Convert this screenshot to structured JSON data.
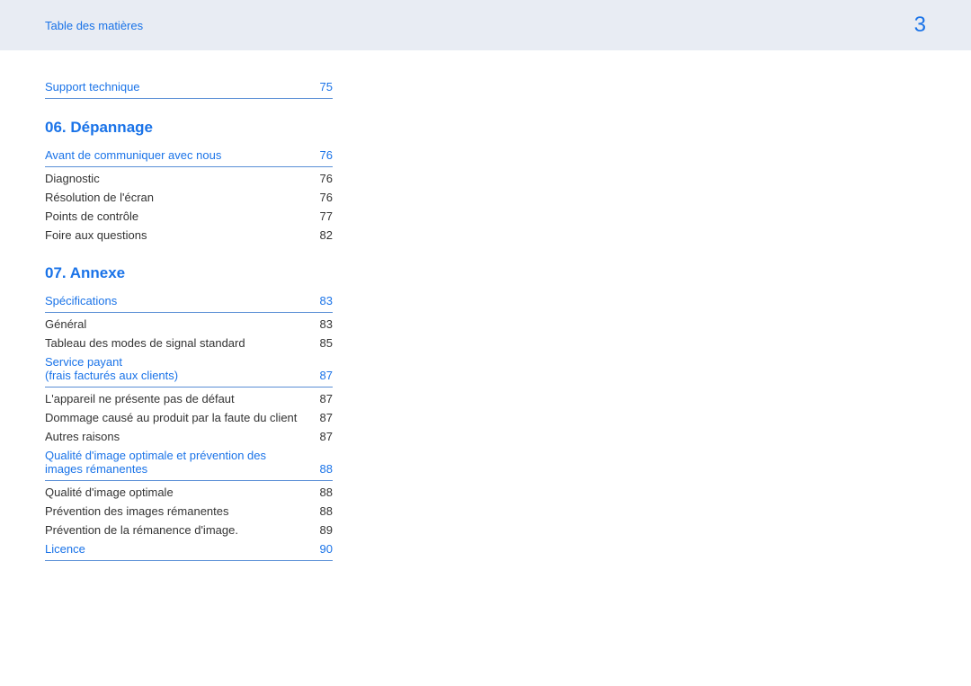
{
  "header": {
    "title": "Table des matières",
    "page_number": "3"
  },
  "top_link": {
    "label": "Support technique",
    "page": "75"
  },
  "sections": [
    {
      "heading": "06. Dépannage",
      "groups": [
        {
          "main": {
            "label": "Avant de communiquer avec nous",
            "page": "76"
          },
          "items": [
            {
              "label": "Diagnostic",
              "page": "76"
            },
            {
              "label": "Résolution de l'écran",
              "page": "76"
            },
            {
              "label": "Points de contrôle",
              "page": "77"
            },
            {
              "label": "Foire aux questions",
              "page": "82"
            }
          ]
        }
      ]
    },
    {
      "heading": "07.  Annexe",
      "groups": [
        {
          "main": {
            "label": "Spécifications",
            "page": "83"
          },
          "items": [
            {
              "label": "Général",
              "page": "83"
            },
            {
              "label": "Tableau des modes de signal standard",
              "page": "85"
            }
          ]
        },
        {
          "main": {
            "label": "Service payant\n(frais facturés aux clients)",
            "page": "87"
          },
          "items": [
            {
              "label": "L'appareil ne présente pas de défaut",
              "page": "87"
            },
            {
              "label": "Dommage causé au produit par la faute du client",
              "page": "87"
            },
            {
              "label": "Autres raisons",
              "page": "87"
            }
          ]
        },
        {
          "main": {
            "label": "Qualité d'image optimale et prévention des images rémanentes",
            "page": "88"
          },
          "items": [
            {
              "label": "Qualité d'image optimale",
              "page": "88"
            },
            {
              "label": "Prévention des images rémanentes",
              "page": "88"
            },
            {
              "label": "Prévention de la rémanence d'image.",
              "page": "89"
            }
          ]
        },
        {
          "main": {
            "label": "Licence",
            "page": "90"
          },
          "items": []
        }
      ]
    }
  ]
}
